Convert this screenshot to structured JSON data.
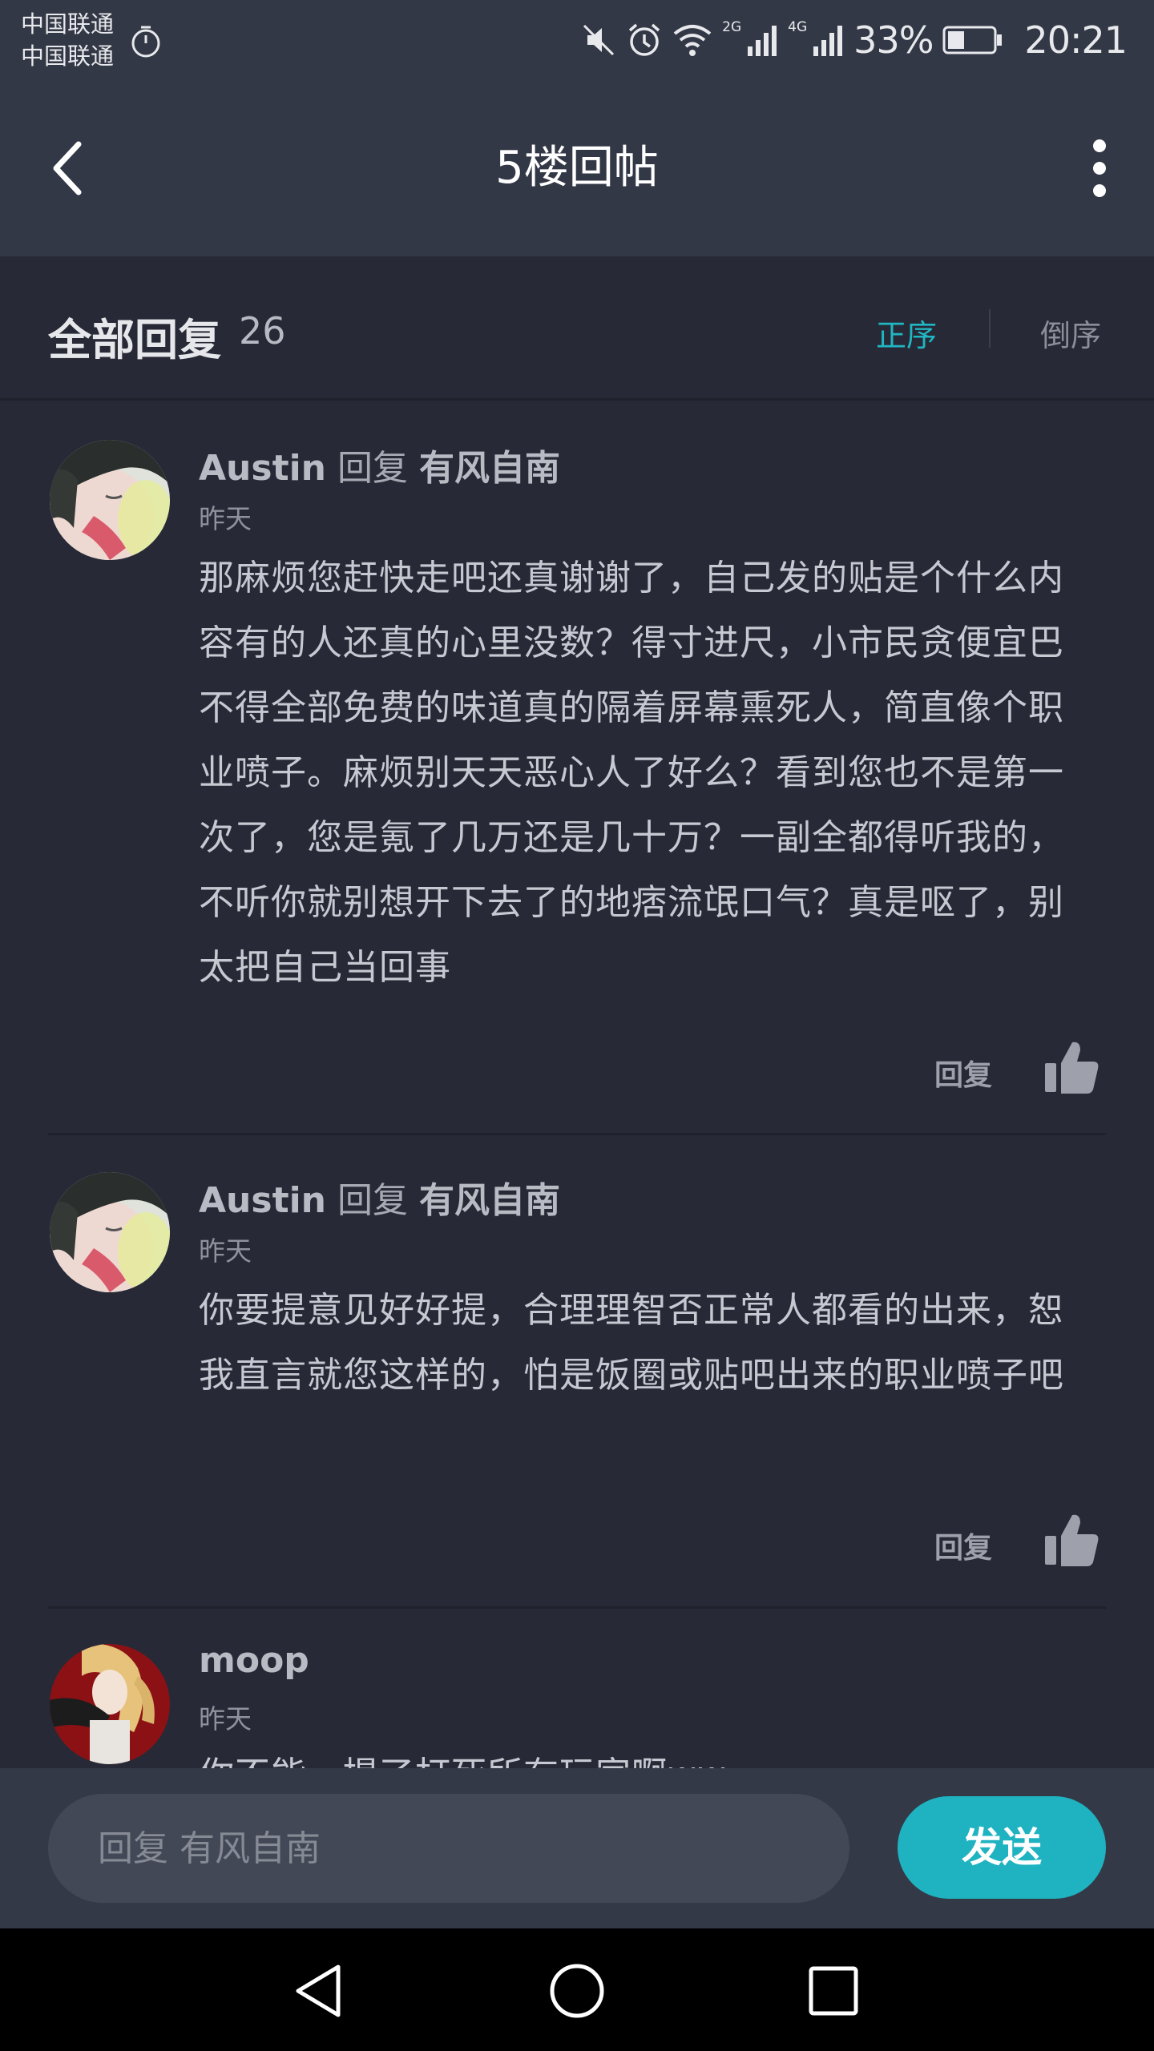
{
  "status_bar": {
    "carrier_1": "中国联通",
    "carrier_2": "中国联通",
    "signal_1_label": "2G",
    "signal_2_label": "4G",
    "battery": "33%",
    "time": "20:21",
    "icons": [
      "stopwatch-icon",
      "mute-icon",
      "alarm-icon",
      "wifi-icon",
      "signal-icon",
      "battery-icon"
    ]
  },
  "header": {
    "title": "5楼回帖",
    "back_icon": "chevron-left-icon",
    "menu_icon": "more-vertical-icon"
  },
  "replies_header": {
    "title": "全部回复",
    "count": "26",
    "sort_asc": "正序",
    "sort_desc": "倒序",
    "active_color": "#20b6c3"
  },
  "comments": [
    {
      "user": "Austin",
      "verb": "回复",
      "target": "有风自南",
      "time": "昨天",
      "body": "那麻烦您赶快走吧还真谢谢了，自己发的贴是个什么内容有的人还真的心里没数？得寸进尺，小市民贪便宜巴不得全部免费的味道真的隔着屏幕熏死人，简直像个职业喷子。麻烦别天天恶心人了好么？看到您也不是第一次了，您是氪了几万还是几十万？一副全都得听我的，不听你就别想开下去了的地痞流氓口气？真是呕了，别太把自己当回事",
      "reply_label": "回复"
    },
    {
      "user": "Austin",
      "verb": "回复",
      "target": "有风自南",
      "time": "昨天",
      "body": "你要提意见好好提，合理理智否正常人都看的出来，恕我直言就您这样的，怕是饭圈或贴吧出来的职业喷子吧",
      "reply_label": "回复"
    },
    {
      "user": "moop",
      "time": "昨天",
      "body": "你不能一提了打死所有玩家啊ww"
    }
  ],
  "input_bar": {
    "placeholder": "回复 有风自南",
    "send_label": "发送",
    "send_color": "#1fb3c1"
  },
  "nav_bar": {
    "icons": [
      "back-triangle-icon",
      "home-circle-icon",
      "recents-square-icon"
    ]
  }
}
